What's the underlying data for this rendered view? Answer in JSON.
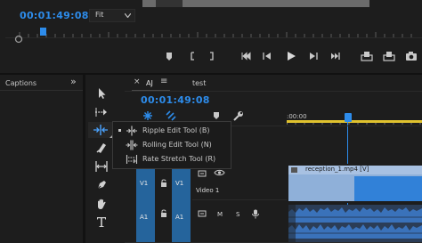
{
  "program_monitor": {
    "timecode": "00:01:49:08",
    "zoom_select": "Fit",
    "zoom_options": [
      "Fit"
    ]
  },
  "captions_panel": {
    "title": "Captions",
    "expand_glyph": "»"
  },
  "tool_flyout": {
    "items": [
      {
        "label": "Ripple Edit Tool (B)",
        "selected": true,
        "icon": "ripple-edit-icon"
      },
      {
        "label": "Rolling Edit Tool (N)",
        "selected": false,
        "icon": "rolling-edit-icon"
      },
      {
        "label": "Rate Stretch Tool (R)",
        "selected": false,
        "icon": "rate-stretch-icon"
      }
    ]
  },
  "timeline": {
    "tabs": [
      {
        "label": "AJ",
        "active": true,
        "close_glyph": "×"
      },
      {
        "label": "test",
        "active": false
      }
    ],
    "menu_glyph": "≡",
    "timecode": "00:01:49:08",
    "ruler_start": ":00:00",
    "tracks": {
      "video": [
        {
          "source": "V1",
          "target": "V1",
          "name": "Video 1"
        }
      ],
      "audio": [
        {
          "source": "A1",
          "target": "A1",
          "mute": "M",
          "solo": "S"
        }
      ]
    },
    "clip": {
      "label": "reception_1.mp4 [V]"
    }
  },
  "colors": {
    "accent": "#2d8ceb",
    "track_blue": "#25649c",
    "clip_video": "#8fb0d9",
    "clip_video_selected": "#3181d8",
    "audio_wave": "#3a72ba",
    "flyout_bg": "#1b1b1b",
    "panel_bg": "#1d1d1d"
  }
}
